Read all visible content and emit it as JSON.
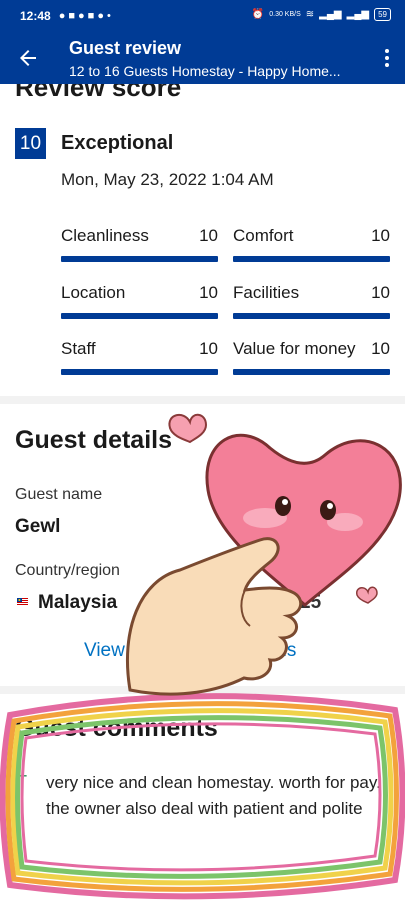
{
  "status_bar": {
    "time": "12:48",
    "battery": "59",
    "net_speed": "0.30 KB/S"
  },
  "app_bar": {
    "title": "Guest review",
    "subtitle": "12 to 16 Guests Homestay - Happy Home..."
  },
  "review_score": {
    "heading": "Review score",
    "score": "10",
    "rating_word": "Exceptional",
    "date": "Mon, May 23, 2022 1:04 AM",
    "metrics": [
      {
        "label": "Cleanliness",
        "value": "10",
        "fill": 1.0
      },
      {
        "label": "Comfort",
        "value": "10",
        "fill": 1.0
      },
      {
        "label": "Location",
        "value": "10",
        "fill": 1.0
      },
      {
        "label": "Facilities",
        "value": "10",
        "fill": 1.0
      },
      {
        "label": "Staff",
        "value": "10",
        "fill": 1.0
      },
      {
        "label": "Value for money",
        "value": "10",
        "fill": 1.0
      }
    ]
  },
  "guest_details": {
    "heading": "Guest details",
    "name_label": "Guest name",
    "name_value": "Gewl",
    "country_label": "Country/region",
    "country_value": "Malaysia",
    "partial_value": "25",
    "view_link_left": "View",
    "view_link_right": "etails"
  },
  "guest_comments": {
    "heading": "Guest comments",
    "comment": "very nice and clean homestay. worth for pay. the owner also deal with patient and polite"
  },
  "colors": {
    "brand": "#003b95",
    "link": "#0071c2",
    "positive": "#2e8b57"
  }
}
